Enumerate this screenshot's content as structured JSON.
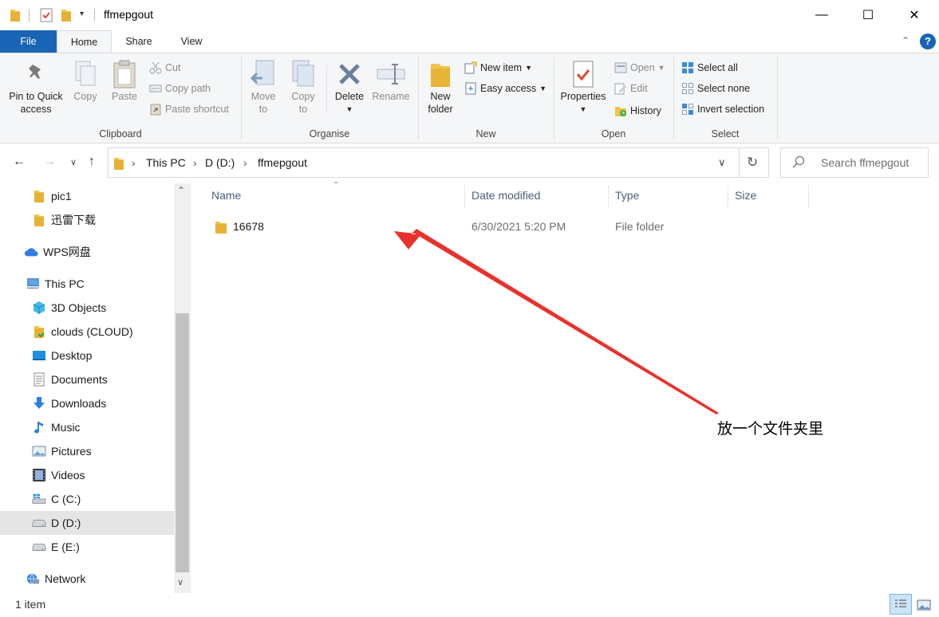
{
  "window": {
    "title": "ffmepgout",
    "minimize_glyph": "—",
    "maximize_glyph": "☐",
    "close_glyph": "✕"
  },
  "ribbon_tabs": {
    "file": "File",
    "home": "Home",
    "share": "Share",
    "view": "View"
  },
  "ribbon": {
    "clipboard": {
      "label": "Clipboard",
      "pin": "Pin to Quick access",
      "pin_line1": "Pin to Quick",
      "pin_line2": "access",
      "copy": "Copy",
      "paste": "Paste",
      "cut": "Cut",
      "copy_path": "Copy path",
      "paste_shortcut": "Paste shortcut"
    },
    "organise": {
      "label": "Organise",
      "move_to_1": "Move",
      "move_to_2": "to",
      "copy_to_1": "Copy",
      "copy_to_2": "to",
      "delete": "Delete",
      "rename": "Rename"
    },
    "new": {
      "label": "New",
      "new_folder_1": "New",
      "new_folder_2": "folder",
      "new_item": "New item",
      "easy_access": "Easy access"
    },
    "open": {
      "label": "Open",
      "properties": "Properties",
      "open": "Open",
      "edit": "Edit",
      "history": "History"
    },
    "select": {
      "label": "Select",
      "select_all": "Select all",
      "select_none": "Select none",
      "invert_selection": "Invert selection"
    }
  },
  "address": {
    "crumbs": [
      "This PC",
      "D (D:)",
      "ffmepgout"
    ],
    "search_placeholder": "Search ffmepgout"
  },
  "sidebar": {
    "items": [
      {
        "label": "pic1",
        "icon": "folder-icon"
      },
      {
        "label": "迅雷下载",
        "icon": "folder-icon"
      },
      {
        "label": "WPS网盘",
        "icon": "cloud-icon"
      },
      {
        "label": "This PC",
        "icon": "computer-icon"
      },
      {
        "label": "3D Objects",
        "icon": "cube-icon"
      },
      {
        "label": "clouds (CLOUD)",
        "icon": "drive-icon"
      },
      {
        "label": "Desktop",
        "icon": "desktop-icon"
      },
      {
        "label": "Documents",
        "icon": "documents-icon"
      },
      {
        "label": "Downloads",
        "icon": "download-icon"
      },
      {
        "label": "Music",
        "icon": "music-icon"
      },
      {
        "label": "Pictures",
        "icon": "pictures-icon"
      },
      {
        "label": "Videos",
        "icon": "videos-icon"
      },
      {
        "label": "C (C:)",
        "icon": "windows-drive-icon"
      },
      {
        "label": "D (D:)",
        "icon": "drive-icon"
      },
      {
        "label": "E (E:)",
        "icon": "drive-icon"
      },
      {
        "label": "Network",
        "icon": "network-icon"
      }
    ]
  },
  "columns": {
    "name": "Name",
    "date_modified": "Date modified",
    "type": "Type",
    "size": "Size"
  },
  "files": [
    {
      "name": "16678",
      "date": "6/30/2021 5:20 PM",
      "type": "File folder",
      "size": ""
    }
  ],
  "annotation": {
    "text": "放一个文件夹里",
    "color": "#e8322d"
  },
  "status": {
    "count": "1 item"
  },
  "colors": {
    "accent": "#1a64b5",
    "folder": "#f0c34a",
    "selected_nav": "#e5e5e5"
  }
}
